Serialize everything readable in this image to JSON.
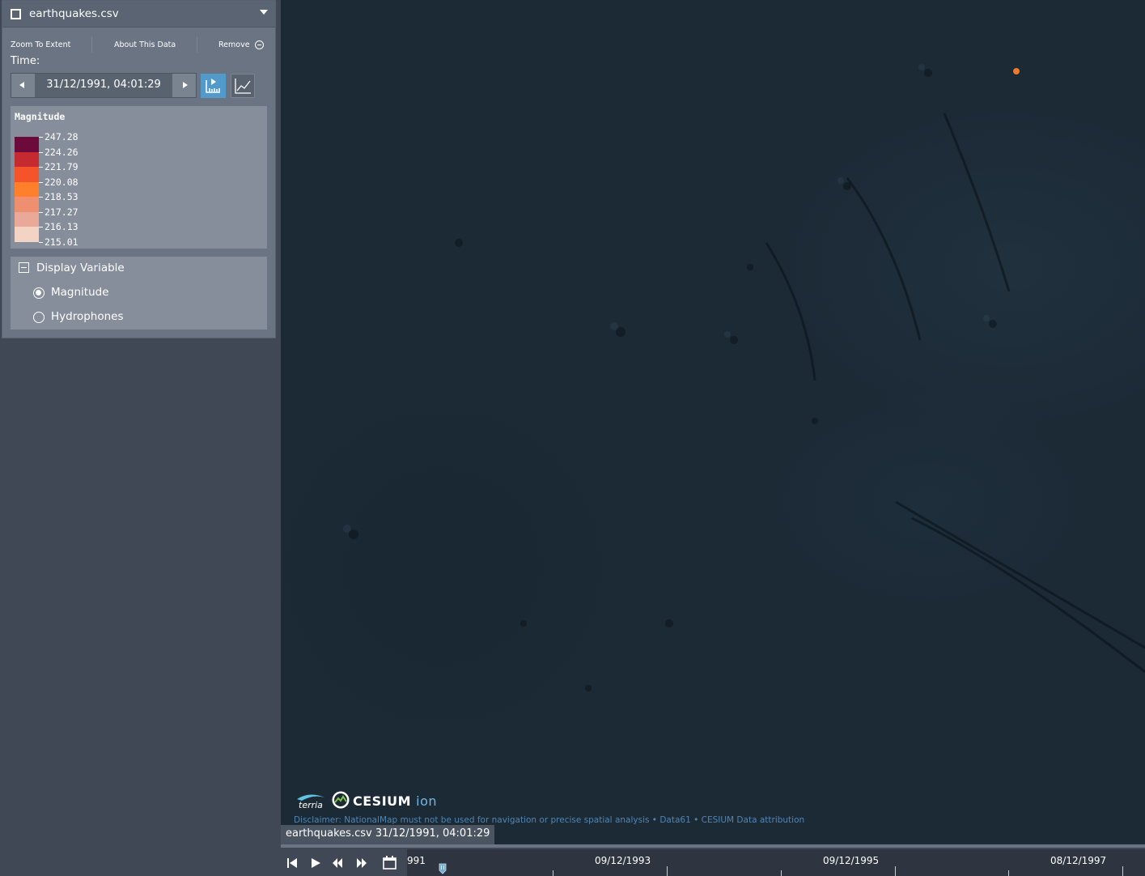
{
  "workbench": {
    "item_title": "earthquakes.csv",
    "actions": {
      "zoom": "Zoom To Extent",
      "about": "About This Data",
      "remove": "Remove"
    },
    "time_label": "Time:",
    "current_time": "31/12/1991, 04:01:29",
    "legend": {
      "title": "Magnitude",
      "colors": [
        "#6b0a3b",
        "#c42a30",
        "#f5532a",
        "#ff7f2a",
        "#ee8f6f",
        "#e9a898",
        "#f3d3c3"
      ],
      "values": [
        "247.28",
        "224.26",
        "221.79",
        "220.08",
        "218.53",
        "217.27",
        "216.13",
        "215.01"
      ]
    },
    "display_variable": {
      "title": "Display Variable",
      "options": [
        {
          "label": "Magnitude",
          "selected": true
        },
        {
          "label": "Hydrophones",
          "selected": false
        }
      ]
    }
  },
  "map": {
    "logos": {
      "cesium_word": "CESIUM",
      "cesium_ion": "ion",
      "terria": "terria"
    },
    "disclaimer": "Disclaimer: NationalMap must not be used for navigation or precise spatial analysis • Data61 • CESIUM  Data attribution",
    "tooltip": "earthquakes.csv 31/12/1991, 04:01:29",
    "point_color": "#f07a2a"
  },
  "timeline": {
    "dates": [
      "991",
      "09/12/1993",
      "09/12/1995",
      "08/12/1997"
    ]
  }
}
